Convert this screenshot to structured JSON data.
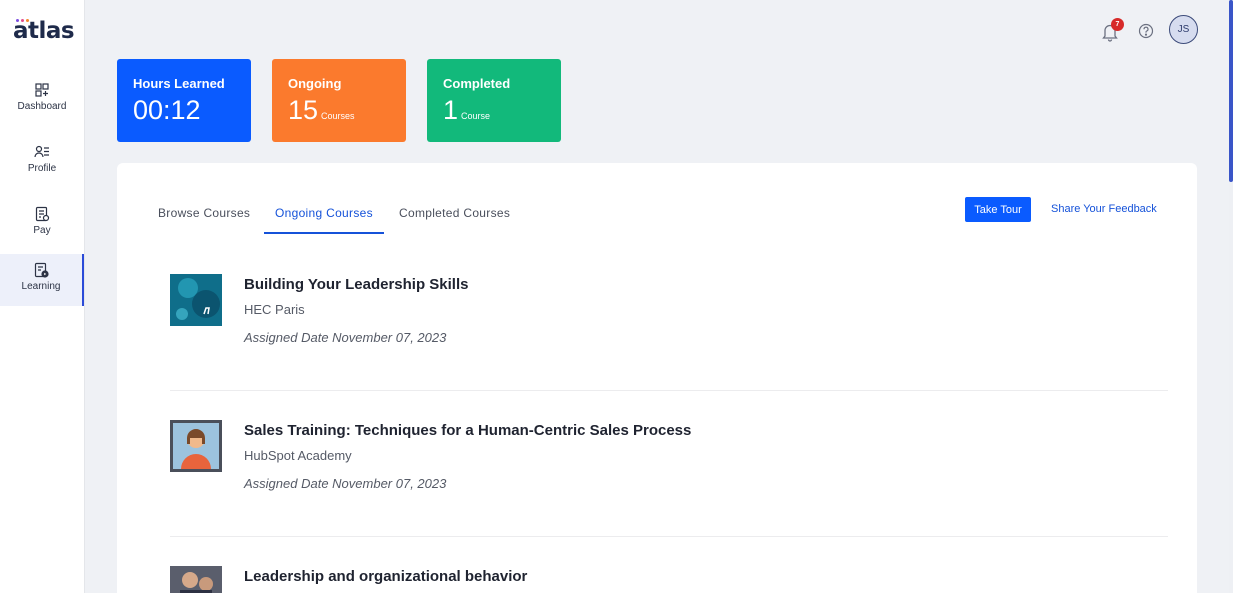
{
  "app": {
    "logo_text": "atlas",
    "brand_colors": [
      "#7b4ce0",
      "#e54c8b",
      "#f58a2e"
    ]
  },
  "sidebar": {
    "items": [
      {
        "label": "Dashboard",
        "icon": "dashboard-grid-icon",
        "active": false
      },
      {
        "label": "Profile",
        "icon": "profile-list-icon",
        "active": false
      },
      {
        "label": "Pay",
        "icon": "pay-document-icon",
        "active": false
      },
      {
        "label": "Learning",
        "icon": "learning-document-icon",
        "active": true
      }
    ]
  },
  "topbar": {
    "notification_count": "7",
    "avatar_initials": "JS"
  },
  "stats": {
    "hours": {
      "title": "Hours Learned",
      "value": "00:12",
      "color": "#0a5bff"
    },
    "ongoing": {
      "title": "Ongoing",
      "value": "15",
      "unit": "Courses",
      "color": "#fb7a2d"
    },
    "completed": {
      "title": "Completed",
      "value": "1",
      "unit": "Course",
      "color": "#12b97b"
    }
  },
  "tabs": [
    {
      "label": "Browse Courses",
      "active": false
    },
    {
      "label": "Ongoing Courses",
      "active": true
    },
    {
      "label": "Completed Courses",
      "active": false
    }
  ],
  "actions": {
    "take_tour_label": "Take Tour",
    "feedback_label": "Share Your Feedback"
  },
  "courses": [
    {
      "title": "Building Your Leadership Skills",
      "provider": "HEC Paris",
      "assigned": "Assigned Date November 07, 2023"
    },
    {
      "title": "Sales Training: Techniques for a Human-Centric Sales Process",
      "provider": "HubSpot Academy",
      "assigned": "Assigned Date November 07, 2023"
    },
    {
      "title": "Leadership and organizational behavior",
      "provider": "",
      "assigned": ""
    }
  ]
}
